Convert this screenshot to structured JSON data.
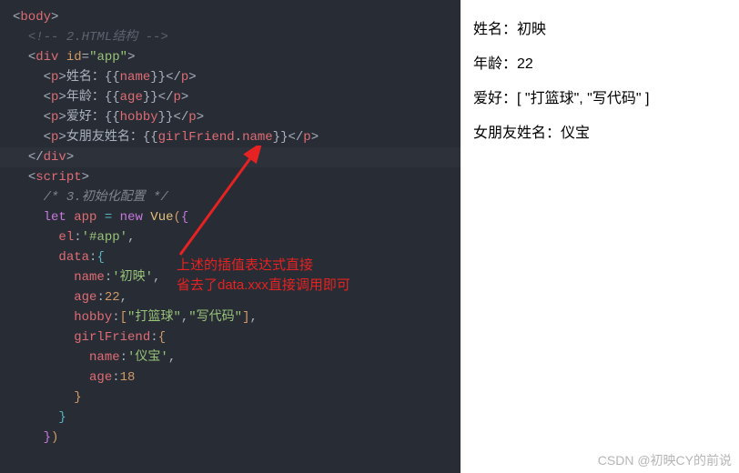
{
  "code": {
    "l1_open_angle": "<",
    "l1_tag": "body",
    "l1_close_angle": ">",
    "l2_open": "<!--",
    "l2_text": " 2.HTML结构 ",
    "l2_close": "-->",
    "l3_open": "<",
    "l3_tag": "div",
    "l3_sp": " ",
    "l3_attr": "id",
    "l3_eq": "=",
    "l3_val": "\"app\"",
    "l3_close": ">",
    "l4_open": "<",
    "l4_tag": "p",
    "l4_close": ">",
    "l4_text": "姓名：",
    "l4_mo": "{{",
    "l4_var": "name",
    "l4_mc": "}}",
    "l4_eopen": "</",
    "l4_etag": "p",
    "l4_eclose": ">",
    "l5_open": "<",
    "l5_tag": "p",
    "l5_close": ">",
    "l5_text": "年龄：",
    "l5_mo": "{{",
    "l5_var": "age",
    "l5_mc": "}}",
    "l5_eopen": "</",
    "l5_etag": "p",
    "l5_eclose": ">",
    "l6_open": "<",
    "l6_tag": "p",
    "l6_close": ">",
    "l6_text": "爱好：",
    "l6_mo": "{{",
    "l6_var": "hobby",
    "l6_mc": "}}",
    "l6_eopen": "</",
    "l6_etag": "p",
    "l6_eclose": ">",
    "l7_open": "<",
    "l7_tag": "p",
    "l7_close": ">",
    "l7_text": "女朋友姓名：",
    "l7_mo": "{{",
    "l7_obj": "girlFriend",
    "l7_dot": ".",
    "l7_prop": "name",
    "l7_mc": "}}",
    "l7_eopen": "</",
    "l7_etag": "p",
    "l7_eclose": ">",
    "l8_open": "</",
    "l8_tag": "div",
    "l8_close": ">",
    "l9_open": "<",
    "l9_tag": "script",
    "l9_close": ">",
    "l10_open": "/*",
    "l10_text": " 3.初始化配置 ",
    "l10_close": "*/",
    "l11_let": "let",
    "l11_sp1": " ",
    "l11_var": "app",
    "l11_sp2": " ",
    "l11_eq": "=",
    "l11_sp3": " ",
    "l11_new": "new",
    "l11_sp4": " ",
    "l11_cls": "Vue",
    "l11_p1": "(",
    "l11_b1": "{",
    "l12_key": "el",
    "l12_colon": ":",
    "l12_val": "'#app'",
    "l12_comma": ",",
    "l13_key": "data",
    "l13_colon": ":",
    "l13_b": "{",
    "l14_key": "name",
    "l14_colon": ":",
    "l14_val": "'初映'",
    "l14_comma": ",",
    "l15_key": "age",
    "l15_colon": ":",
    "l15_val": "22",
    "l15_comma": ",",
    "l16_key": "hobby",
    "l16_colon": ":",
    "l16_b1": "[",
    "l16_v1": "\"打篮球\"",
    "l16_comma1": ",",
    "l16_v2": "\"写代码\"",
    "l16_b2": "]",
    "l16_comma2": ",",
    "l17_key": "girlFriend",
    "l17_colon": ":",
    "l17_b": "{",
    "l18_key": "name",
    "l18_colon": ":",
    "l18_val": "'仪宝'",
    "l18_comma": ",",
    "l19_key": "age",
    "l19_colon": ":",
    "l19_val": "18",
    "l20_b": "}",
    "l21_b": "}",
    "l22_b": "}",
    "l22_p": ")"
  },
  "output": {
    "line1": "姓名：初映",
    "line2": "年龄：22",
    "line3": "爱好：[ \"打篮球\", \"写代码\" ]",
    "line4": "女朋友姓名：仪宝"
  },
  "annotation": {
    "line1": "上述的插值表达式直接",
    "line2": "省去了data.xxx直接调用即可"
  },
  "watermark": "CSDN @初映CY的前说"
}
